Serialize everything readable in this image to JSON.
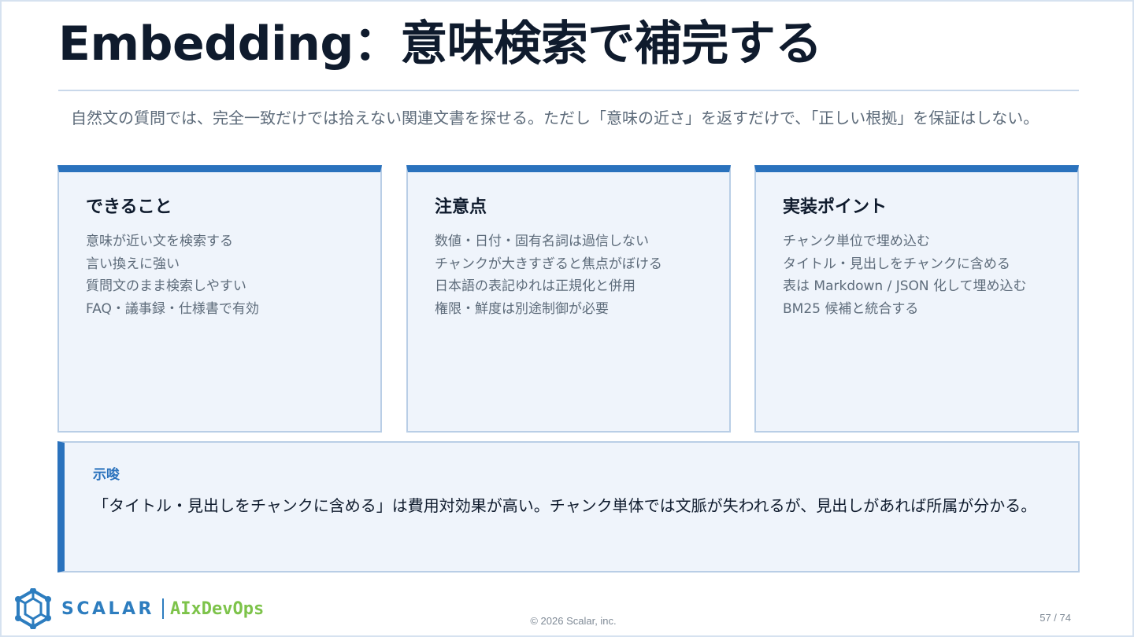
{
  "slide": {
    "title": "Embedding：意味検索で補完する",
    "lead": "自然文の質問では、完全一致だけでは拾えない関連文書を探せる。ただし「意味の近さ」を返すだけで、「正しい根拠」を保証はしない。"
  },
  "cards": [
    {
      "heading": "できること",
      "items": [
        "意味が近い文を検索する",
        "言い換えに強い",
        "質問文のまま検索しやすい",
        "FAQ・議事録・仕様書で有効"
      ]
    },
    {
      "heading": "注意点",
      "items": [
        "数値・日付・固有名詞は過信しない",
        "チャンクが大きすぎると焦点がぼける",
        "日本語の表記ゆれは正規化と併用",
        "権限・鮮度は別途制御が必要"
      ]
    },
    {
      "heading": "実装ポイント",
      "items": [
        "チャンク単位で埋め込む",
        "タイトル・見出しをチャンクに含める",
        "表は Markdown / JSON 化して埋め込む",
        "BM25 候補と統合する"
      ]
    }
  ],
  "callout": {
    "label": "示唆",
    "body": "「タイトル・見出しをチャンクに含める」は費用対効果が高い。チャンク単体では文脈が失われるが、見出しがあれば所属が分かる。"
  },
  "footer": {
    "brand": "SCALAR",
    "product": "AIxDevOps",
    "copyright": "© 2026 Scalar, inc.",
    "page": "57 / 74"
  },
  "colors": {
    "accent": "#2a72bd",
    "card_bg": "#eff4fb",
    "brand_green": "#7dc34a"
  },
  "icons": {
    "logo": "scalar-hexagon-logo-icon"
  }
}
